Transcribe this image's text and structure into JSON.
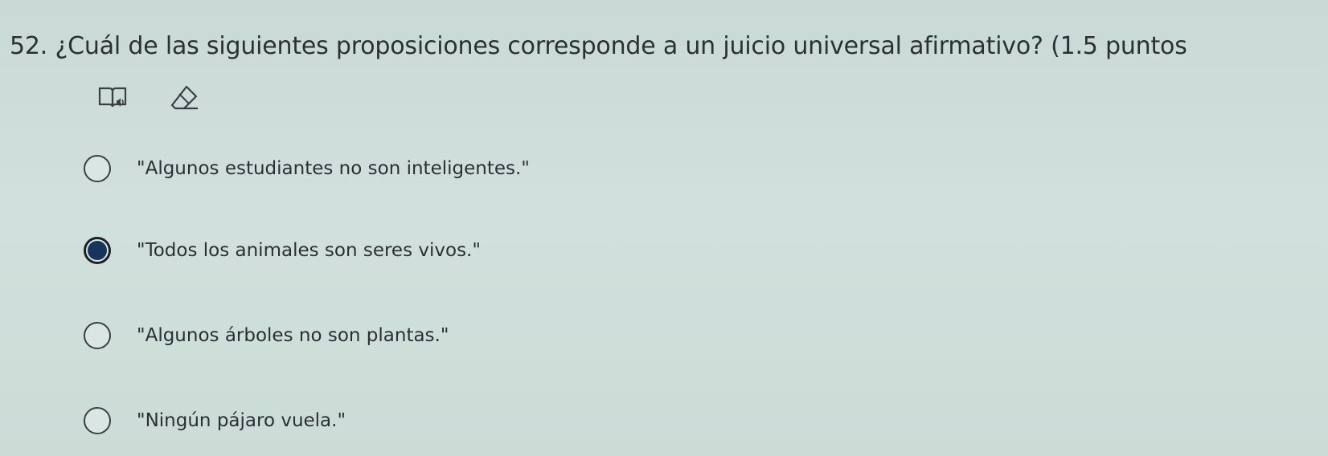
{
  "question": {
    "title": "52. ¿Cuál de las siguientes proposiciones corresponde a un juicio universal afirmativo? (1.5 puntos"
  },
  "tools": {
    "reader_icon": "immersive-reader-icon",
    "eraser_icon": "eraser-icon"
  },
  "options": [
    {
      "label": "\"Algunos estudiantes no son inteligentes.\"",
      "selected": false
    },
    {
      "label": "\"Todos los animales son seres vivos.\"",
      "selected": true
    },
    {
      "label": "\"Algunos árboles no son plantas.\"",
      "selected": false
    },
    {
      "label": "\"Ningún pájaro vuela.\"",
      "selected": false
    }
  ],
  "colors": {
    "background": "#cfdfdb",
    "selected_dot": "#17345c",
    "text": "#2a2f33"
  }
}
